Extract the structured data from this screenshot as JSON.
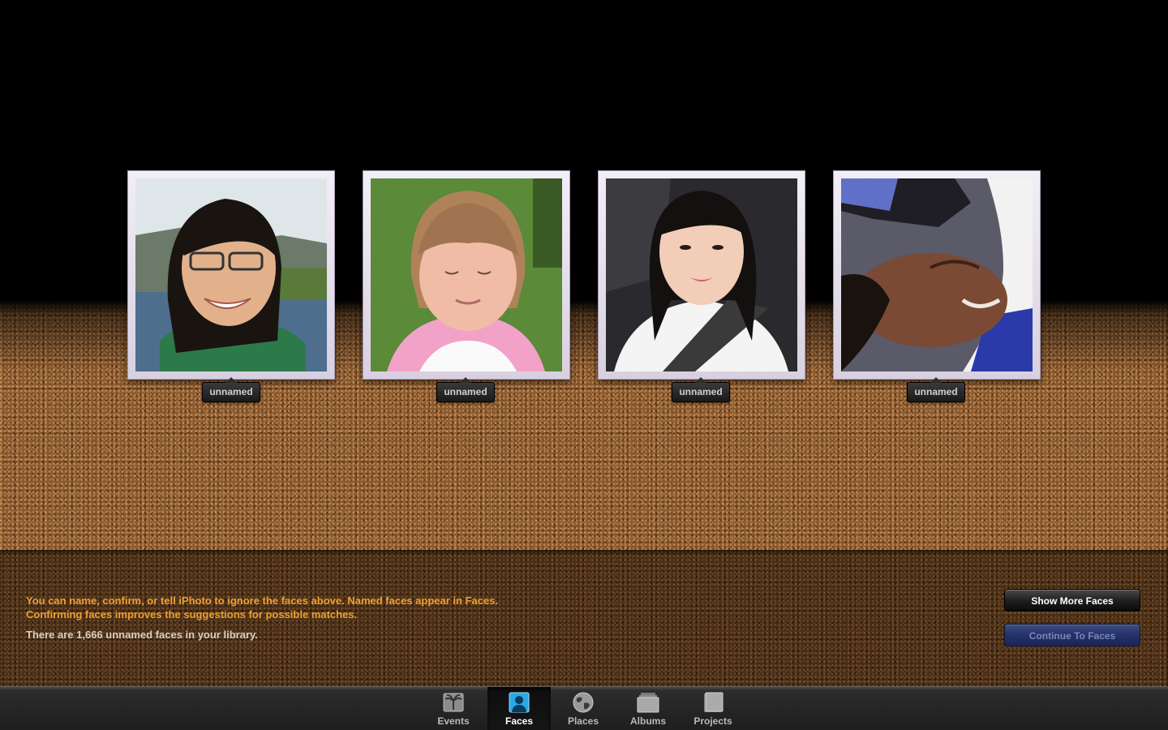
{
  "faces": [
    {
      "name_label": "unnamed"
    },
    {
      "name_label": "unnamed"
    },
    {
      "name_label": "unnamed"
    },
    {
      "name_label": "unnamed"
    }
  ],
  "info": {
    "line1": "You can name, confirm, or tell iPhoto to ignore the faces above. Named faces appear in Faces.",
    "line2": "Confirming faces improves the suggestions for possible matches.",
    "count": "There are 1,666 unnamed faces in your library."
  },
  "buttons": {
    "show_more": "Show More Faces",
    "continue": "Continue To Faces"
  },
  "toolbar": {
    "items": [
      {
        "label": "Events",
        "icon": "palm-tree-icon",
        "active": false
      },
      {
        "label": "Faces",
        "icon": "person-portrait-icon",
        "active": true
      },
      {
        "label": "Places",
        "icon": "globe-icon",
        "active": false
      },
      {
        "label": "Albums",
        "icon": "album-stack-icon",
        "active": false
      },
      {
        "label": "Projects",
        "icon": "book-icon",
        "active": false
      }
    ]
  },
  "colors": {
    "info_text": "#f0a030",
    "count_text": "#d8cfc6",
    "active_tab_icon": "#2aa8e8"
  }
}
